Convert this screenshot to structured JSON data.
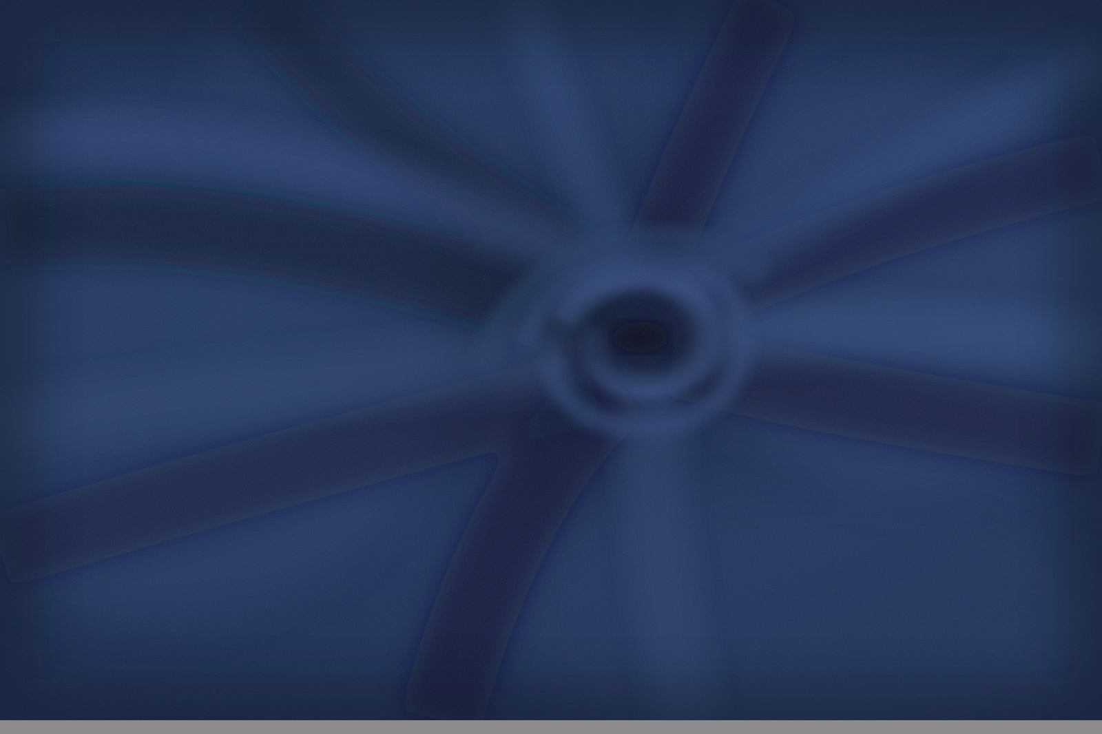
{
  "image": {
    "subject": "navy-knit-fabric-swirl",
    "colors": {
      "fabric_base": "#1e2d4e",
      "fabric_light": "#2f4470",
      "fabric_shadow": "#0c1428",
      "fold_highlight": "#3a5282",
      "bottom_strip": "#8c8c8c"
    }
  }
}
